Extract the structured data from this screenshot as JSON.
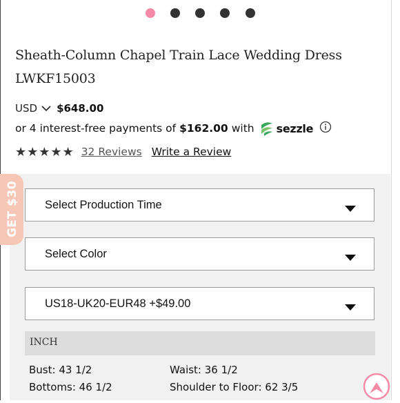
{
  "carousel": {
    "dot_count": 5,
    "active_index": 0,
    "active_color": "#f48aa6",
    "inactive_color": "#333333"
  },
  "product": {
    "title_line1": "Sheath-Column Chapel Train Lace Wedding Dress",
    "title_line2": "LWKF15003"
  },
  "price": {
    "currency": "USD",
    "amount": "$648.00"
  },
  "installments": {
    "prefix": "or 4 interest-free payments of",
    "amount": "$162.00",
    "suffix": "with",
    "provider": "sezzle",
    "provider_icon": "sezzle-leaf-icon",
    "info_icon": "info-icon",
    "provider_color": "#3ca85d"
  },
  "reviews": {
    "stars": 5,
    "stars_glyph": "★★★★★",
    "count_label": "32 Reviews",
    "write_label": "Write a Review"
  },
  "promo": {
    "label": "GET $30",
    "color": "#f6c7b6"
  },
  "selects": [
    {
      "label": "Select Production Time"
    },
    {
      "label": "Select Color"
    },
    {
      "label": "US18-UK20-EUR48 +$49.00"
    }
  ],
  "measurements": {
    "unit": "INCH",
    "bust_label": "Bust:",
    "bust_value": "43 1/2",
    "waist_label": "Waist:",
    "waist_value": "36 1/2",
    "bottoms_label": "Bottoms:",
    "bottoms_value": "46 1/2",
    "shoulder_label": "Shoulder to Floor:",
    "shoulder_value": "62 3/5"
  },
  "back_to_top": {
    "icon": "arrow-up-icon",
    "color": "#f48aa6"
  }
}
